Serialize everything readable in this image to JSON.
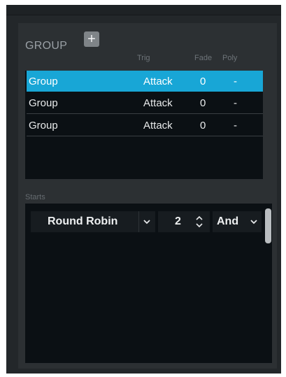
{
  "group_section": {
    "title": "GROUP",
    "add_label": "+",
    "columns": {
      "trig": "Trig",
      "fade": "Fade",
      "poly": "Poly"
    },
    "rows": [
      {
        "name": "Group",
        "trig": "Attack",
        "fade": "0",
        "poly": "-",
        "selected": true
      },
      {
        "name": "Group",
        "trig": "Attack",
        "fade": "0",
        "poly": "-",
        "selected": false
      },
      {
        "name": "Group",
        "trig": "Attack",
        "fade": "0",
        "poly": "-",
        "selected": false
      }
    ]
  },
  "starts_section": {
    "label": "Starts",
    "mode": "Round Robin",
    "count": "2",
    "logic": "And",
    "icons": {
      "mode_dropdown": "chevron-down-icon",
      "count_stepper": "stepper-up-down-icon",
      "logic_dropdown": "chevron-down-icon"
    }
  },
  "colors": {
    "panel": "#23272a",
    "inner": "#2c3033",
    "list_bg": "#0b1014",
    "selection": "#18a6d6",
    "scrollbar": "#b9bdc0"
  }
}
